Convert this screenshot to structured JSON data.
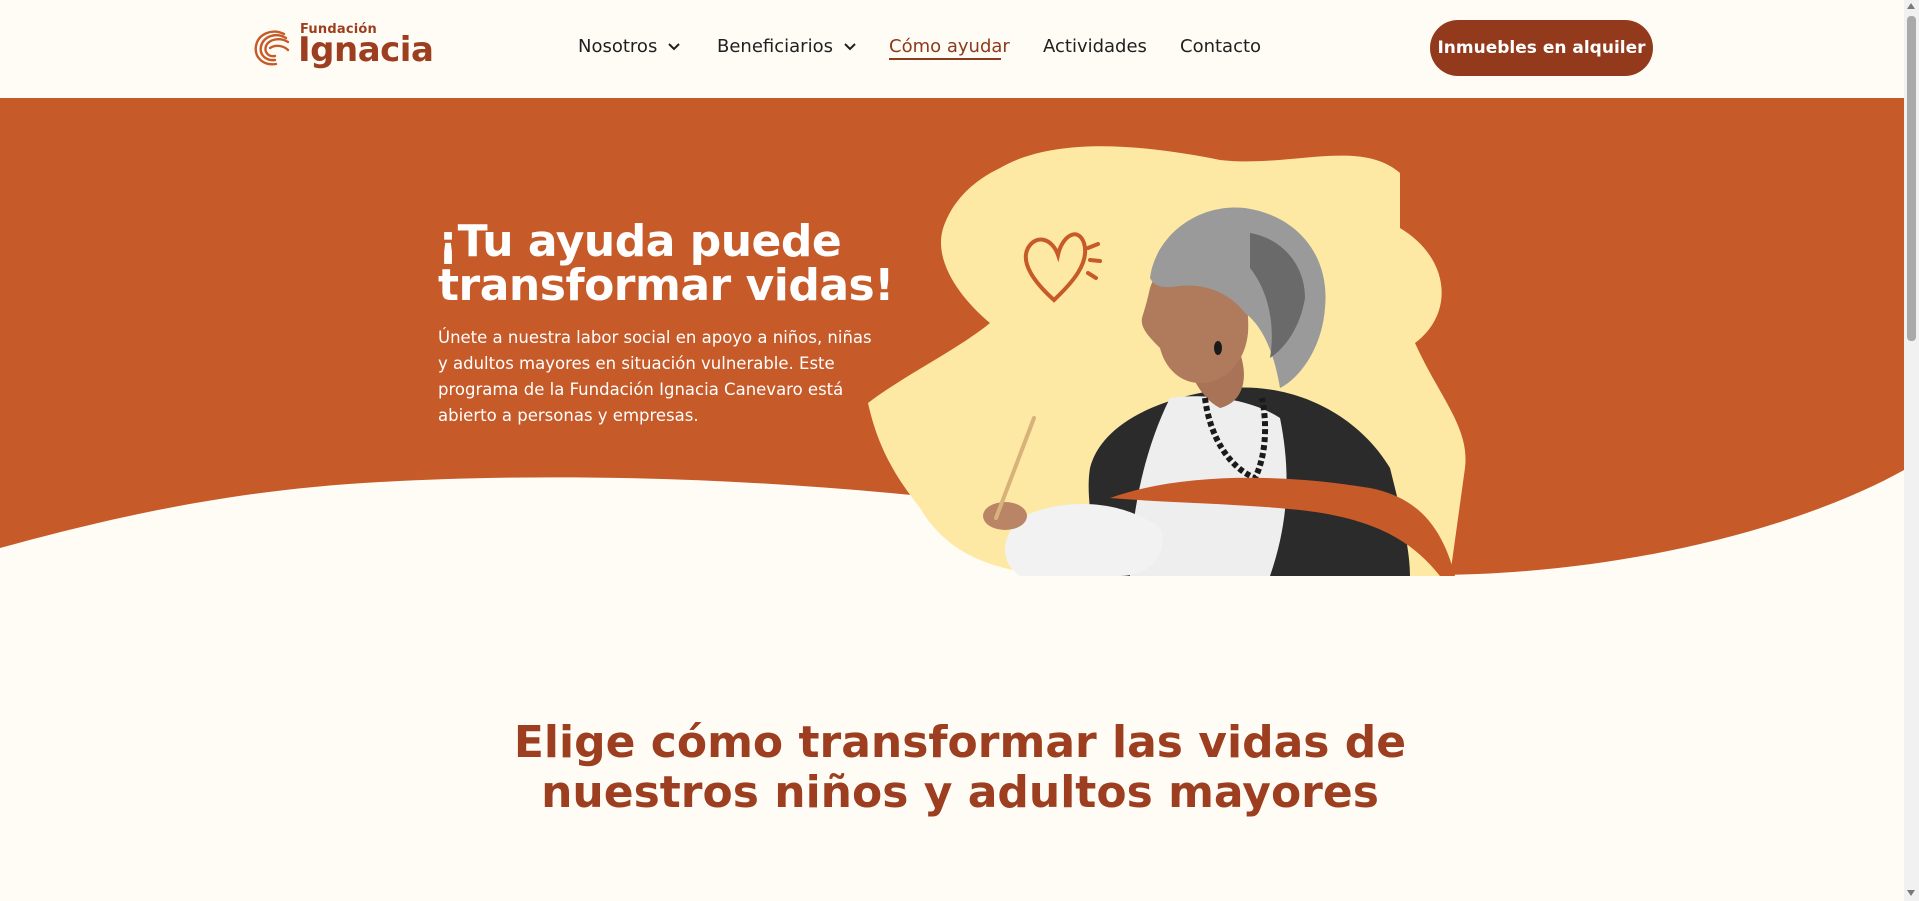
{
  "header": {
    "logo": {
      "small": "Fundación",
      "big": "Ignacia"
    },
    "nav": [
      {
        "label": "Nosotros",
        "dropdown": true
      },
      {
        "label": "Beneficiarios",
        "dropdown": true
      },
      {
        "label": "Cómo ayudar",
        "active": true
      },
      {
        "label": "Actividades"
      },
      {
        "label": "Contacto"
      }
    ],
    "cta_label": "Inmuebles en alquiler"
  },
  "hero": {
    "title": "¡Tu ayuda puede transformar vidas!",
    "text": "Únete a nuestra labor social en apoyo a niños, niñas y adultos mayores en situación vulnerable. Este programa de la Fundación Ignacia Canevaro está abierto a personas y empresas.",
    "image": "elderly-woman-writing-illustration"
  },
  "section": {
    "title": "Elige cómo transformar las vidas de nuestros niños y adultos mayores"
  },
  "colors": {
    "brand": "#9c3e1f",
    "hero_bg": "#c65a29",
    "cta_bg": "#93391c",
    "blob": "#fde9a3",
    "page_bg": "#fefcf4"
  },
  "icons": [
    "chevron-down-icon",
    "heart-icon",
    "logo-mark-icon"
  ]
}
